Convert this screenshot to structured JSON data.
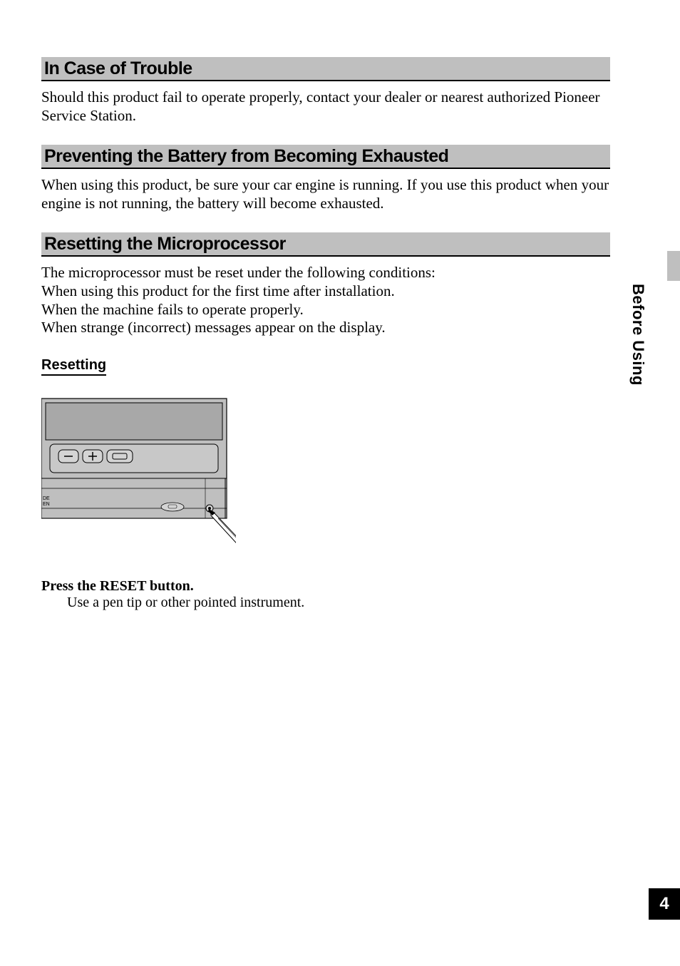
{
  "sections": {
    "s1": {
      "heading": "In Case of Trouble",
      "body": "Should this product fail to operate properly, contact your dealer or nearest authorized Pioneer Service Station."
    },
    "s2": {
      "heading": "Preventing the Battery from Becoming Exhausted",
      "body": "When using this product, be sure your car engine is running. If you use this product when your engine is not running, the battery will become exhausted."
    },
    "s3": {
      "heading": "Resetting the Microprocessor",
      "line1": "The microprocessor must be reset under the following conditions:",
      "line2": "When using this product for the first time after installation.",
      "line3": "When the machine fails to operate properly.",
      "line4": "When strange (incorrect) messages appear on the display."
    }
  },
  "resetting": {
    "sub_heading": "Resetting",
    "instruction_bold": "Press the RESET button.",
    "instruction_body": "Use a pen tip or other pointed instrument."
  },
  "side": {
    "label": "Before Using"
  },
  "page_number": "4"
}
